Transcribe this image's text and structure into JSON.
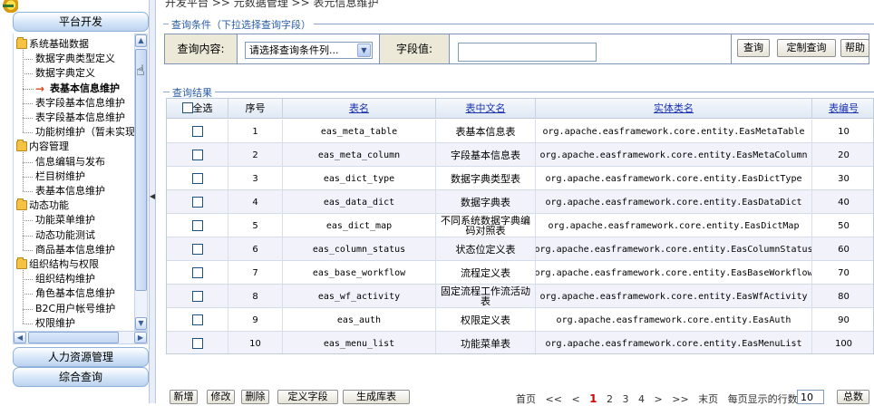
{
  "breadcrumb": "开发平台 >> 元数据管理 >> 表元信息维护",
  "sidebar": {
    "top_section": "平台开发",
    "bottom_sections": [
      "人力资源管理",
      "综合查询"
    ],
    "tree": [
      {
        "type": "folder",
        "label": "系统基础数据"
      },
      {
        "type": "leaf",
        "label": "数据字典类型定义"
      },
      {
        "type": "leaf",
        "label": "数据字典定义"
      },
      {
        "type": "current",
        "label": "表基本信息维护"
      },
      {
        "type": "leaf",
        "label": "表字段基本信息维护"
      },
      {
        "type": "leaf",
        "label": "表字段基本信息维护"
      },
      {
        "type": "leaf",
        "label": "功能树维护（暂未实现）"
      },
      {
        "type": "folder",
        "label": "内容管理"
      },
      {
        "type": "leaf",
        "label": "信息编辑与发布"
      },
      {
        "type": "leaf",
        "label": "栏目树维护"
      },
      {
        "type": "leaf",
        "label": "表基本信息维护"
      },
      {
        "type": "folder",
        "label": "动态功能"
      },
      {
        "type": "leaf",
        "label": "功能菜单维护"
      },
      {
        "type": "leaf",
        "label": "动态功能测试"
      },
      {
        "type": "leaf",
        "label": "商品基本信息维护"
      },
      {
        "type": "folder",
        "label": "组织结构与权限"
      },
      {
        "type": "leaf",
        "label": "组织结构维护"
      },
      {
        "type": "leaf",
        "label": "角色基本信息维护"
      },
      {
        "type": "leaf",
        "label": "B2C用户帐号维护"
      },
      {
        "type": "leaf",
        "label": "权限维护"
      }
    ]
  },
  "query": {
    "section_title": "查询条件（下拉选择查询字段）",
    "content_label": "查询内容:",
    "select_value": "请选择查询条件列...",
    "field_label": "字段值:",
    "field_value": "",
    "query_button": "查询",
    "custom_query_button": "定制查询",
    "help_button": "帮助"
  },
  "results": {
    "section_title": "查询结果",
    "headers": {
      "select_all": "全选",
      "seq": "序号",
      "table_name": "表名",
      "cn_name": "表中文名",
      "entity_class": "实体类名",
      "table_no": "表编号"
    },
    "rows": [
      {
        "seq": "1",
        "table_name": "eas_meta_table",
        "cn_name": "表基本信息表",
        "entity_class": "org.apache.easframework.core.entity.EasMetaTable",
        "table_no": "10"
      },
      {
        "seq": "2",
        "table_name": "eas_meta_column",
        "cn_name": "字段基本信息表",
        "entity_class": "org.apache.easframework.core.entity.EasMetaColumn",
        "table_no": "20"
      },
      {
        "seq": "3",
        "table_name": "eas_dict_type",
        "cn_name": "数据字典类型表",
        "entity_class": "org.apache.easframework.core.entity.EasDictType",
        "table_no": "30"
      },
      {
        "seq": "4",
        "table_name": "eas_data_dict",
        "cn_name": "数据字典表",
        "entity_class": "org.apache.easframework.core.entity.EasDataDict",
        "table_no": "40"
      },
      {
        "seq": "5",
        "table_name": "eas_dict_map",
        "cn_name": "不同系统数据字典编码对照表",
        "entity_class": "org.apache.easframework.core.entity.EasDictMap",
        "table_no": "50"
      },
      {
        "seq": "6",
        "table_name": "eas_column_status",
        "cn_name": "状态位定义表",
        "entity_class": "org.apache.easframework.core.entity.EasColumnStatus",
        "table_no": "60"
      },
      {
        "seq": "7",
        "table_name": "eas_base_workflow",
        "cn_name": "流程定义表",
        "entity_class": "org.apache.easframework.core.entity.EasBaseWorkflow",
        "table_no": "70"
      },
      {
        "seq": "8",
        "table_name": "eas_wf_activity",
        "cn_name": "固定流程工作流活动表",
        "entity_class": "org.apache.easframework.core.entity.EasWfActivity",
        "table_no": "80"
      },
      {
        "seq": "9",
        "table_name": "eas_auth",
        "cn_name": "权限定义表",
        "entity_class": "org.apache.easframework.core.entity.EasAuth",
        "table_no": "90"
      },
      {
        "seq": "10",
        "table_name": "eas_menu_list",
        "cn_name": "功能菜单表",
        "entity_class": "org.apache.easframework.core.entity.EasMenuList",
        "table_no": "100"
      }
    ]
  },
  "toolbar": {
    "add": "新增",
    "edit": "修改",
    "delete": "删除",
    "define_fields": "定义字段",
    "generate_table": "生成库表"
  },
  "pager": {
    "first": "首页",
    "prev_group": "<<",
    "prev": "<",
    "pages": [
      "1",
      "2",
      "3",
      "4"
    ],
    "current_page": "1",
    "next": ">",
    "next_group": ">>",
    "last": "末页",
    "rows_label": "每页显示的行数",
    "rows_value": "10",
    "total_label": "总数"
  }
}
